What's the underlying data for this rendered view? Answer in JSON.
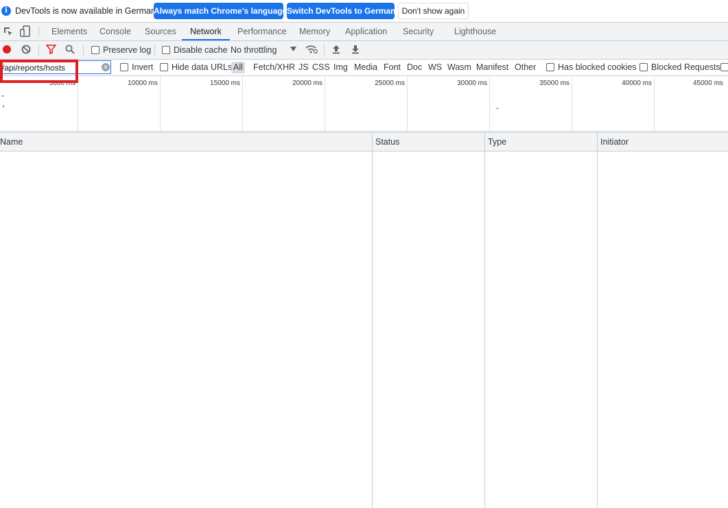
{
  "infobar": {
    "message": "DevTools is now available in German!",
    "btn_match": "Always match Chrome's language",
    "btn_switch": "Switch DevTools to German",
    "btn_dismiss": "Don't show again"
  },
  "tabs": [
    "Elements",
    "Console",
    "Sources",
    "Network",
    "Performance",
    "Memory",
    "Application",
    "Security",
    "Lighthouse"
  ],
  "active_tab": "Network",
  "toolbar": {
    "preserve_log": "Preserve log",
    "disable_cache": "Disable cache",
    "throttling": "No throttling"
  },
  "filter": {
    "value": "/api/reports/hosts",
    "invert": "Invert",
    "hide_data_urls": "Hide data URLs",
    "types": [
      "All",
      "Fetch/XHR",
      "JS",
      "CSS",
      "Img",
      "Media",
      "Font",
      "Doc",
      "WS",
      "Wasm",
      "Manifest",
      "Other"
    ],
    "has_blocked_cookies": "Has blocked cookies",
    "blocked_requests": "Blocked Requests"
  },
  "timeline": {
    "labels": [
      "5000 ms",
      "10000 ms",
      "15000 ms",
      "20000 ms",
      "25000 ms",
      "30000 ms",
      "35000 ms",
      "40000 ms",
      "45000 ms"
    ]
  },
  "table": {
    "columns": [
      "Name",
      "Status",
      "Type",
      "Initiator"
    ]
  },
  "colors": {
    "accent": "#1a73e8",
    "record": "#e0201b",
    "highlight": "#e02020"
  }
}
